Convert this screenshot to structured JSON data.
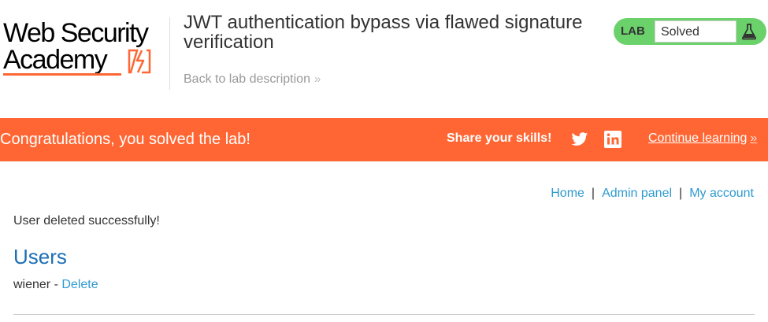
{
  "header": {
    "logo": {
      "line1": "Web Security",
      "line2": "Academy"
    },
    "lab_title": "JWT authentication bypass via flawed signature verification",
    "back_link": {
      "label": "Back to lab description",
      "chevron": "»"
    },
    "status_widget": {
      "lab_label": "LAB",
      "status": "Solved",
      "icon": "flask-icon",
      "color": "#6bd16b"
    }
  },
  "banner": {
    "message": "Congratulations, you solved the lab!",
    "share_label": "Share your skills!",
    "share_icons": [
      "twitter-icon",
      "linkedin-icon"
    ],
    "continue_label": "Continue learning",
    "continue_chevron": "»",
    "color": "#ff6633"
  },
  "nav": {
    "home": "Home",
    "separator": "|",
    "admin_panel": "Admin panel",
    "my_account": "My account"
  },
  "main": {
    "message": "User deleted successfully!",
    "heading": "Users",
    "users": [
      {
        "name": "wiener",
        "separator": "-",
        "action": "Delete"
      }
    ]
  }
}
